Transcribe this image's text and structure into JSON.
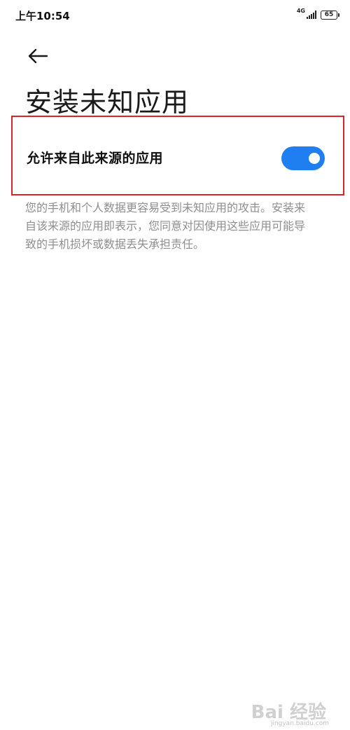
{
  "status_bar": {
    "time": "上午10:54",
    "network": "4G",
    "battery": "65"
  },
  "header": {
    "back_icon": "arrow-left-icon",
    "title": "安装未知应用"
  },
  "setting": {
    "label": "允许来自此来源的应用",
    "enabled": true,
    "toggle_color": "#1f7ff0",
    "highlight_color": "#d9232d"
  },
  "description": "您的手机和个人数据更容易受到未知应用的攻击。安装来自该来源的应用即表示，您同意对因使用这些应用可能导致的手机损坏或数据丢失承担责任。",
  "watermark": {
    "logo": "Bai 经验",
    "url": "jingyan.baidu.com"
  }
}
